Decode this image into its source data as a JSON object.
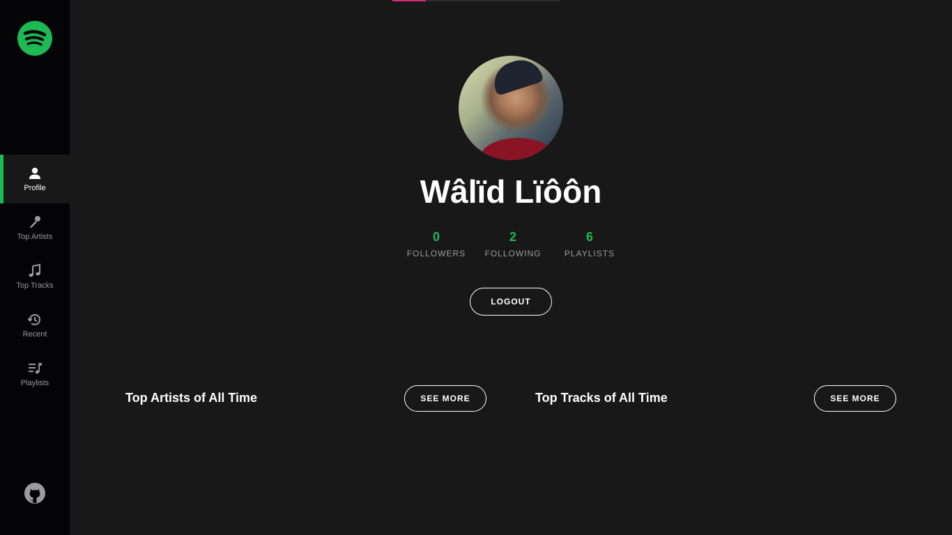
{
  "nav": {
    "items": [
      {
        "label": "Profile",
        "icon": "user-icon",
        "active": true
      },
      {
        "label": "Top Artists",
        "icon": "microphone-icon",
        "active": false
      },
      {
        "label": "Top Tracks",
        "icon": "music-note-icon",
        "active": false
      },
      {
        "label": "Recent",
        "icon": "history-icon",
        "active": false
      },
      {
        "label": "Playlists",
        "icon": "playlist-icon",
        "active": false
      }
    ]
  },
  "brand": {
    "logo": "spotify-logo-icon",
    "accent": "#1db954"
  },
  "profile": {
    "name": "Wâlïd Lïôôn",
    "stats": [
      {
        "value": "0",
        "label": "FOLLOWERS"
      },
      {
        "value": "2",
        "label": "FOLLOWING"
      },
      {
        "value": "6",
        "label": "PLAYLISTS"
      }
    ],
    "logout_label": "LOGOUT"
  },
  "sections": {
    "artists": {
      "title": "Top Artists of All Time",
      "button": "SEE MORE"
    },
    "tracks": {
      "title": "Top Tracks of All Time",
      "button": "SEE MORE"
    }
  },
  "colors": {
    "background": "#181818",
    "sidebar": "#040306",
    "muted": "#9b9b9b"
  }
}
